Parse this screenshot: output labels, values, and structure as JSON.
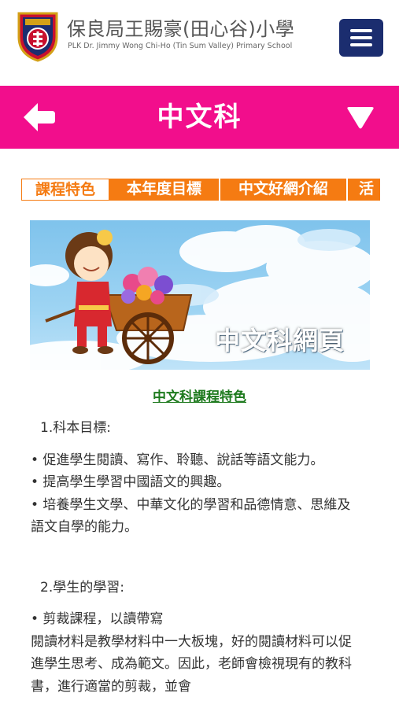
{
  "header": {
    "school_name_zh": "保良局王賜豪(田心谷)小學",
    "school_name_en": "PLK Dr. Jimmy Wong Chi-Ho (Tin Sum Valley) Primary School",
    "logo_icon": "school-crest-icon",
    "menu_icon": "hamburger-menu-icon",
    "menu_color": "#1b2d6f"
  },
  "titlebar": {
    "title": "中文科",
    "color": "#f20e8c",
    "back_icon": "arrow-left-icon",
    "dropdown_icon": "triangle-down-icon"
  },
  "tabs": [
    {
      "label": "課程特色",
      "active": true
    },
    {
      "label": "本年度目標",
      "active": false
    },
    {
      "label": "中文好網介紹",
      "active": false
    },
    {
      "label": "活",
      "active": false
    }
  ],
  "tab_color": "#f57b12",
  "banner": {
    "text": "中文科網頁"
  },
  "section_title": "中文科課程特色",
  "content": {
    "heading1": "1.科本目標:",
    "goals": [
      "• 促進學生閱讀、寫作、聆聽、說話等語文能力。",
      "• 提高學生學習中國語文的興趣。",
      "• 培養學生文學、中華文化的學習和品德情意、思維及語文自學的能力。"
    ],
    "heading2": "2.學生的學習:",
    "item_title": "• 剪裁課程，以讀帶寫",
    "item_body": "閱讀材料是教學材料中一大板塊，好的閱讀材料可以促進學生思考、成為範文。因此，老師會檢視現有的教科書，進行適當的剪裁，並會"
  }
}
